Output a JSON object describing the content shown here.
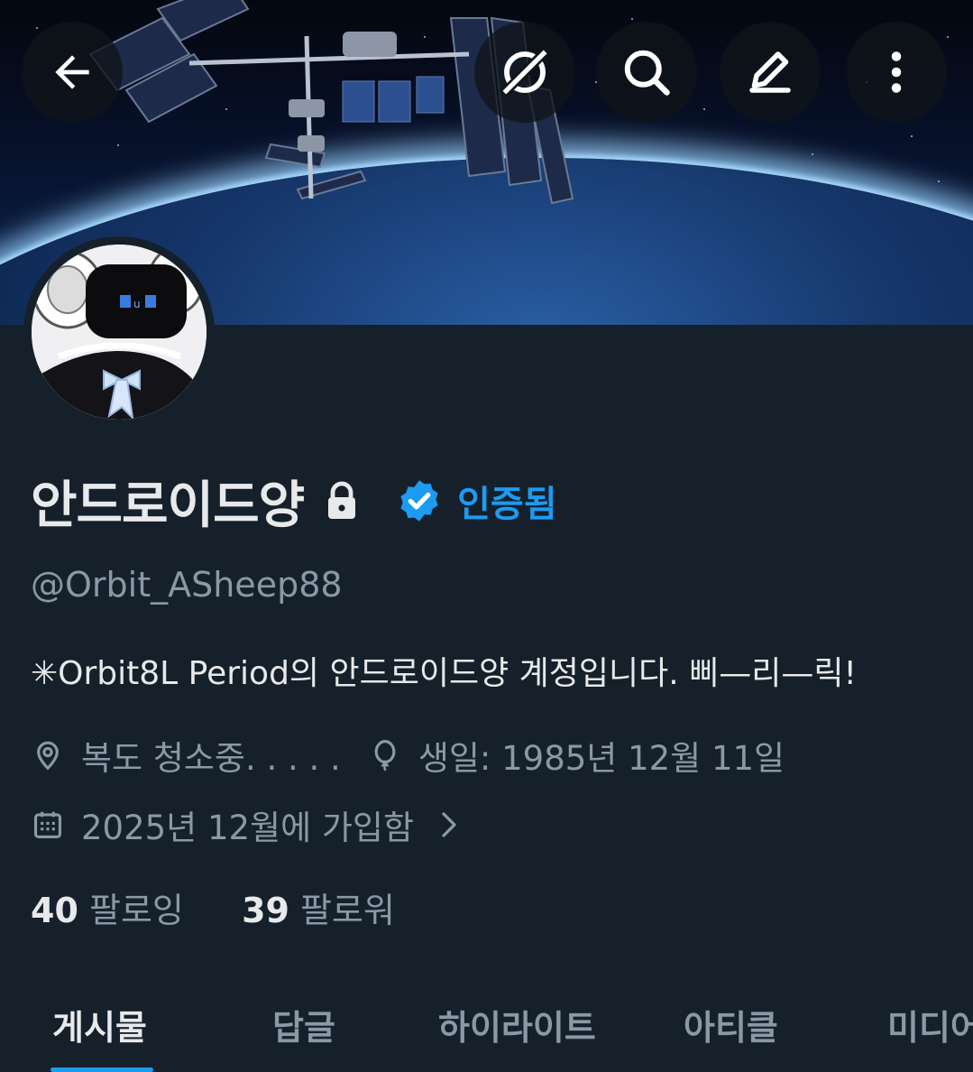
{
  "header": {
    "back_icon": "arrow-left-icon",
    "grok_icon": "grok-icon",
    "search_icon": "search-icon",
    "edit_icon": "edit-icon",
    "more_icon": "more-vertical-icon"
  },
  "profile": {
    "display_name": "안드로이드양",
    "protected_icon": "lock-icon",
    "verified_icon": "verified-badge-icon",
    "verified_label": "인증됨",
    "handle": "@Orbit_ASheep88",
    "bio": "✳Orbit8L Period의 안드로이드양 계정입니다. 삐—리—릭!",
    "location": "복도 청소중. . . . .",
    "birthday": "생일: 1985년 12월 11일",
    "joined": "2025년 12월에 가입함",
    "following_count": "40",
    "following_label": "팔로잉",
    "followers_count": "39",
    "followers_label": "팔로워"
  },
  "tabs": [
    {
      "label": "게시물",
      "active": true
    },
    {
      "label": "답글",
      "active": false
    },
    {
      "label": "하이라이트",
      "active": false
    },
    {
      "label": "아티클",
      "active": false
    },
    {
      "label": "미디어",
      "active": false
    }
  ],
  "colors": {
    "background": "#15202b",
    "accent": "#1d9bf0",
    "secondary_text": "#8b98a5"
  }
}
